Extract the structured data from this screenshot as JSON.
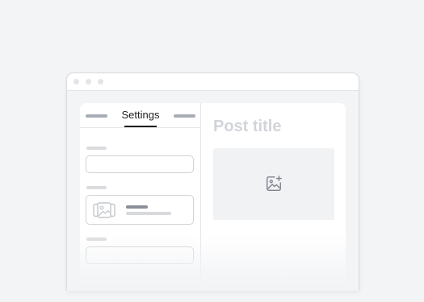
{
  "settings": {
    "tabs": [
      {
        "label": ""
      },
      {
        "label": "Settings",
        "active": true
      },
      {
        "label": ""
      }
    ]
  },
  "editor": {
    "title_placeholder": "Post title",
    "image_icon": "add-image-icon"
  },
  "icons": {
    "media": "gallery-icon",
    "add_image": "image-plus-icon"
  },
  "colors": {
    "background": "#f3f4f6",
    "panel": "#ffffff",
    "active_tab": "#1e1e1e",
    "placeholder_text": "#d1d4d9"
  }
}
